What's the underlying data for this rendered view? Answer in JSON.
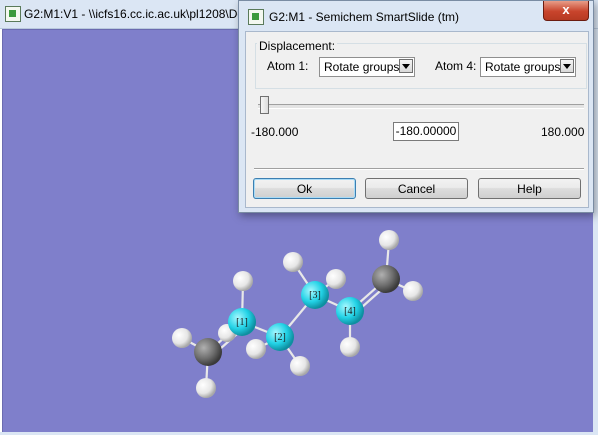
{
  "viewer": {
    "title": "G2:M1:V1 - \\\\icfs16.cc.ic.ac.uk\\pl1208\\De",
    "icon": "gaussview-app-icon"
  },
  "molecule": {
    "atom_labels": [
      "[1]",
      "[2]",
      "[3]",
      "[4]"
    ],
    "colors": {
      "highlight": "#22d2e6",
      "carbon": "#6e6e6e",
      "hydrogen": "#f2f2f2",
      "background": "#7f7fcb"
    }
  },
  "dialog": {
    "title": "G2:M1 - Semichem SmartSlide (tm)",
    "close_label": "x",
    "displacement": {
      "label": "Displacement:",
      "atom1_label": "Atom 1:",
      "atom1_value": "Rotate groups",
      "atom4_label": "Atom 4:",
      "atom4_value": "Rotate groups"
    },
    "slider": {
      "min_label": "-180.000",
      "max_label": "180.000",
      "value": "-180.00000",
      "position_fraction": 0
    },
    "buttons": {
      "ok": "Ok",
      "cancel": "Cancel",
      "help": "Help"
    },
    "colors": {
      "frame": "#dbe6f4",
      "close": "#c8442c"
    }
  }
}
